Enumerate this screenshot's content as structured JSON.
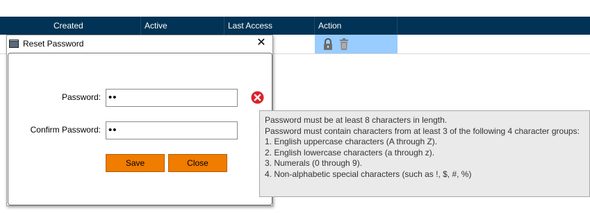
{
  "grid": {
    "columns": [
      "Created",
      "Active",
      "Last Access",
      "Action"
    ]
  },
  "dialog": {
    "title": "Reset Password",
    "close_glyph": "✕",
    "password_label": "Password:",
    "password_value": "••",
    "confirm_label": "Confirm Password:",
    "confirm_value": "••",
    "save_label": "Save",
    "close_label": "Close"
  },
  "tooltip": {
    "lines": [
      "Password must be at least 8 characters in length.",
      "Password must contain characters from at least 3 of the following 4 character groups:",
      "1. English uppercase characters (A through Z).",
      "2. English lowercase characters (a through z).",
      "3. Numerals (0 through 9).",
      "4. Non-alphabetic special characters (such as !, $, #, %)"
    ]
  },
  "colors": {
    "header_bg": "#003355",
    "selected_cell": "#99ccff",
    "button_orange": "#f07c00",
    "error_red": "#d9232e"
  },
  "icons": {
    "action": [
      "lock-icon",
      "trash-icon"
    ],
    "validation": "error-icon",
    "window": "app-window-icon"
  }
}
